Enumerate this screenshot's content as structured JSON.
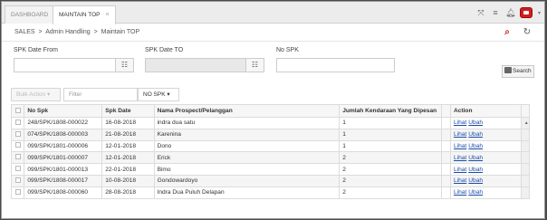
{
  "tabs": [
    {
      "label": "DASHBOARD"
    },
    {
      "label": "MAINTAIN TOP",
      "close": "×"
    }
  ],
  "breadcrumb": {
    "root": "SALES",
    "parent": "Admin Handling",
    "current": "Maintain TOP",
    "sep": ">"
  },
  "form": {
    "spk_date_from_label": "SPK Date From",
    "spk_date_to_label": "SPK Date TO",
    "no_spk_label": "No SPK",
    "spk_date_from_value": "",
    "spk_date_to_value": "",
    "no_spk_value": "",
    "search_label": "Search"
  },
  "action_bar": {
    "bulk_action": "Bulk Action ▾",
    "filter_placeholder": "Filter",
    "column_select": "NO SPK ▾"
  },
  "table": {
    "columns": [
      "No Spk",
      "Spk Date",
      "Nama Prospect/Pelanggan",
      "Jumlah Kendaraan Yang Dipesan",
      "Action"
    ],
    "rows": [
      {
        "no_spk": "248/SPK/1808-000022",
        "date": "16-08-2018",
        "nama": "indra dua satu",
        "jumlah": "1"
      },
      {
        "no_spk": "074/SPK/1808-000003",
        "date": "21-08-2018",
        "nama": "Karenina",
        "jumlah": "1"
      },
      {
        "no_spk": "099/SPK/1801-000006",
        "date": "12-01-2018",
        "nama": "Dono",
        "jumlah": "1"
      },
      {
        "no_spk": "099/SPK/1801-000007",
        "date": "12-01-2018",
        "nama": "Erick",
        "jumlah": "2"
      },
      {
        "no_spk": "099/SPK/1801-000013",
        "date": "22-01-2018",
        "nama": "Bimo",
        "jumlah": "2"
      },
      {
        "no_spk": "099/SPK/1808-000017",
        "date": "10-08-2018",
        "nama": "Gondowardoyo",
        "jumlah": "2"
      },
      {
        "no_spk": "099/SPK/1808-000060",
        "date": "28-08-2018",
        "nama": "Indra Dua Puluh Delapan",
        "jumlah": "2"
      }
    ],
    "link_lihat": "Lihat",
    "link_ubah": "Ubah"
  },
  "colors": {
    "accent": "#d32222",
    "link": "#1a4ba8"
  },
  "icons": [
    "expand-icon",
    "menu-icon",
    "bell-icon",
    "user-icon",
    "search-icon",
    "refresh-icon",
    "calendar-icon"
  ]
}
